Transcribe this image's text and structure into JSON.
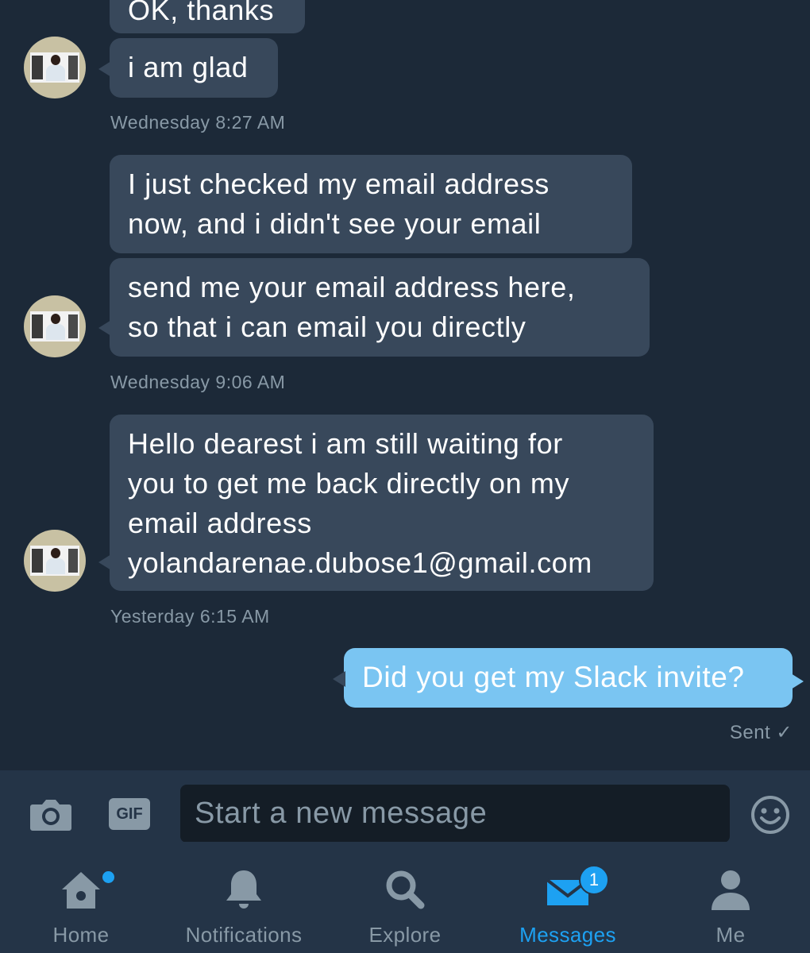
{
  "conversation": {
    "messages": [
      {
        "id": "m1",
        "text": "OK, thanks",
        "direction": "received"
      },
      {
        "id": "m2",
        "text": "i am glad",
        "direction": "received"
      },
      {
        "id": "m3",
        "text": "I just  checked my email address\nnow, and i didn't see your email",
        "direction": "received"
      },
      {
        "id": "m4",
        "text": "send me your email address here,\nso that i can email you directly",
        "direction": "received"
      },
      {
        "id": "m5",
        "text": "Hello dearest i am still waiting for\nyou to get me back directly on my\nemail address\nyolandarenae.dubose1@gmail.com",
        "direction": "received"
      },
      {
        "id": "m6",
        "text": "Did you get my Slack invite?",
        "direction": "sent"
      }
    ],
    "timestamps": [
      "Wednesday 8:27 AM",
      "Wednesday 9:06 AM",
      "Yesterday 6:15 AM"
    ],
    "sent_status": "Sent ✓"
  },
  "composer": {
    "placeholder": "Start a new message",
    "camera_icon": "camera-icon",
    "gif_label": "GIF",
    "emoji_icon": "emoji-icon"
  },
  "tabbar": {
    "tabs": [
      {
        "label": "Home",
        "icon": "home-icon",
        "has_dot": true
      },
      {
        "label": "Notifications",
        "icon": "bell-icon"
      },
      {
        "label": "Explore",
        "icon": "search-icon"
      },
      {
        "label": "Messages",
        "icon": "envelope-icon",
        "active": true,
        "badge": "1"
      },
      {
        "label": "Me",
        "icon": "person-icon"
      }
    ]
  },
  "colors": {
    "background": "#1c2938",
    "received_bubble": "#38485b",
    "sent_bubble": "#7ac5f2",
    "accent": "#1da1f2",
    "muted_text": "#8899a6",
    "bar": "#243447"
  }
}
